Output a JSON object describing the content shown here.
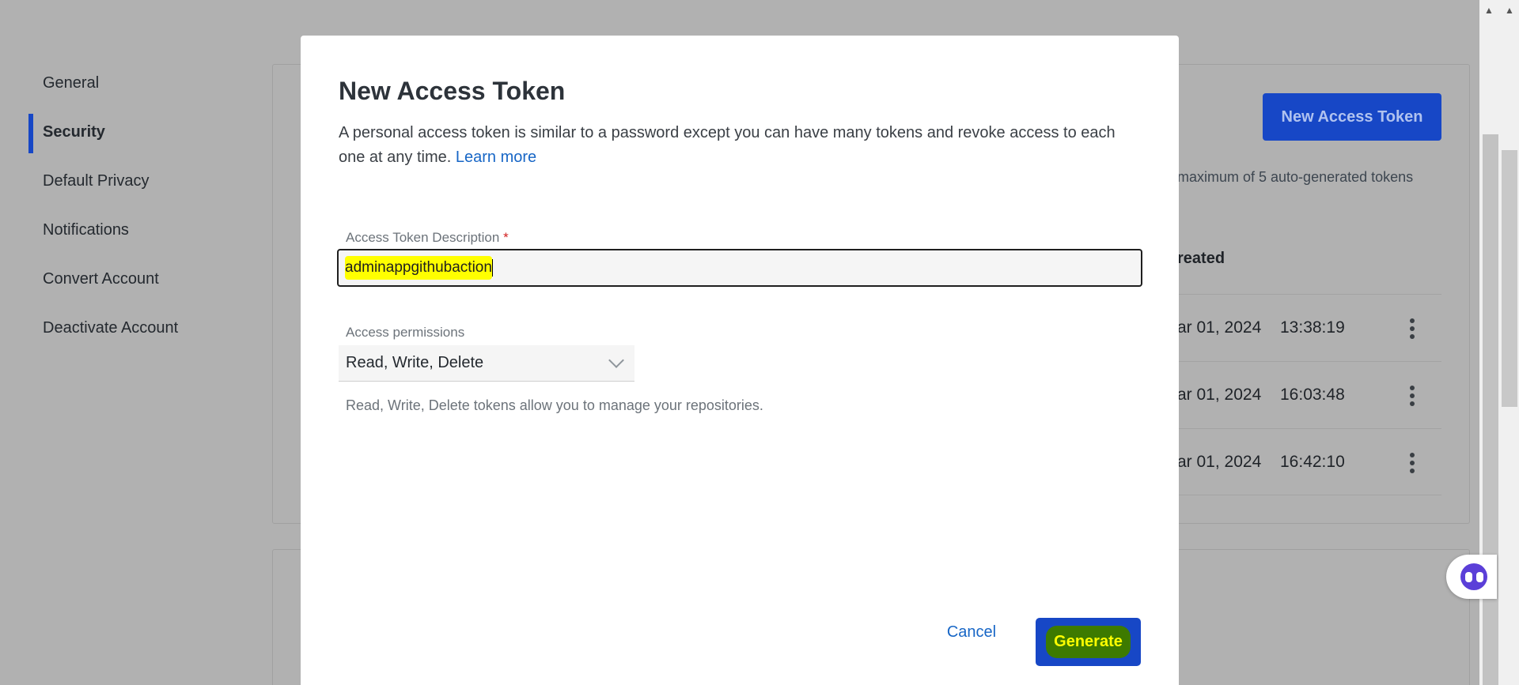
{
  "sidebar": {
    "items": [
      {
        "label": "General"
      },
      {
        "label": "Security",
        "active": true
      },
      {
        "label": "Default Privacy"
      },
      {
        "label": "Notifications"
      },
      {
        "label": "Convert Account"
      },
      {
        "label": "Deactivate Account"
      }
    ]
  },
  "background": {
    "new_token_button": "New Access Token",
    "max_note": "maximum of 5 auto-generated tokens",
    "created_header": "reated",
    "tokens": [
      {
        "date": "ar 01, 2024",
        "time": "13:38:19"
      },
      {
        "date": "ar 01, 2024",
        "time": "16:03:48"
      },
      {
        "date": "ar 01, 2024",
        "time": "16:42:10"
      }
    ]
  },
  "modal": {
    "title": "New Access Token",
    "description": "A personal access token is similar to a password except you can have many tokens and revoke access to each one at any time.",
    "learn_more": "Learn more",
    "desc_field": {
      "label": "Access Token Description",
      "required_mark": "*",
      "value": "adminappgithubaction"
    },
    "permissions": {
      "label": "Access permissions",
      "selected": "Read, Write, Delete",
      "help": "Read, Write, Delete tokens allow you to manage your repositories."
    },
    "cancel_label": "Cancel",
    "generate_label": "Generate"
  },
  "colors": {
    "primary": "#1747c6",
    "link": "#1766c6",
    "highlight": "#ffff00"
  },
  "icons": [
    "kebab-menu-icon",
    "chevron-down-icon",
    "assistant-icon"
  ]
}
